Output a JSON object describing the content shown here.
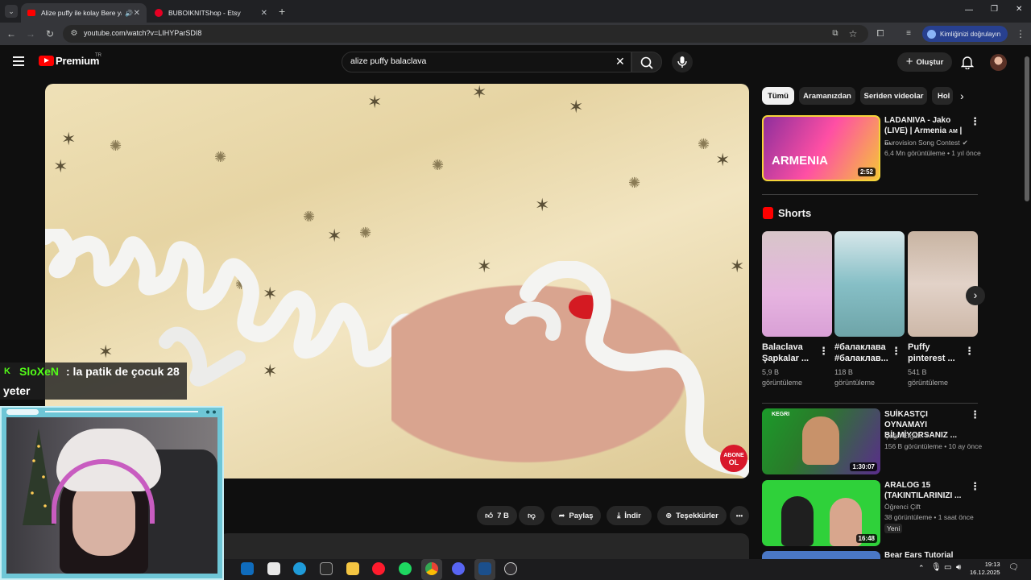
{
  "browser": {
    "tabs": [
      {
        "title": "Alize puffy ile kolay Bere ya",
        "favicon_color": "#ff0000"
      },
      {
        "title": "BUBOIKNITShop - Etsy",
        "favicon_color": "#e60023"
      }
    ],
    "new_tab_symbol": "+",
    "url": "youtube.com/watch?v=LIHYParSDI8",
    "profile_label": "Kimliğinizi doğrulayın"
  },
  "header": {
    "logo_text": "Premium",
    "logo_sup": "TR",
    "search_query": "alize puffy balaclava",
    "create_label": "Oluştur"
  },
  "video": {
    "subscribe_badge_line1": "ABONE",
    "subscribe_badge_line2": "OL"
  },
  "actions": {
    "likes": "7 B",
    "share": "Paylaş",
    "download": "İndir",
    "thanks": "Teşekkürler",
    "more": "•••"
  },
  "chat": {
    "badge": "K",
    "username": "SloXeN",
    "message": ": la patik de çocuk 28",
    "message_cont": "yeter"
  },
  "sidebar": {
    "chips": [
      "Tümü",
      "Aramanızdan",
      "Seriden videolar",
      "Hol"
    ],
    "video1": {
      "title": "LADANIVA - Jako (LIVE) | Armenia",
      "title_suffix": "AM",
      "channel": "Eurovision Song Contest",
      "meta": "6,4 Mn görüntüleme • 1 yıl önce",
      "duration": "2:52",
      "thumb_text": "ARMENIA"
    },
    "shorts_heading": "Shorts",
    "shorts": [
      {
        "title": "Balaclava Şapkalar ...",
        "views": "5,9 B görüntüleme"
      },
      {
        "title": "#балаклава #балаклав...",
        "views": "118 B görüntüleme"
      },
      {
        "title": "Puffy pinterest ...",
        "views": "541 B görüntüleme"
      }
    ],
    "video2": {
      "title": "SUİKASTÇI OYNAMAYI BİLMİYORSANIZ ...",
      "channel": "Çağrı Ergün",
      "meta": "156 B görüntüleme • 10 ay önce",
      "duration": "1:30:07",
      "thumb_text": "KEGRI"
    },
    "video3": {
      "title": "ARALOG 15 (TAKINTILARINIZI ...",
      "channel": "Öğrenci Çift",
      "meta": "38 görüntüleme • 1 saat önce",
      "badge": "Yeni",
      "duration": "16:48"
    },
    "video4": {
      "title": "Bear Ears Tutorial"
    }
  },
  "taskbar": {
    "time": "19:13",
    "date": "16.12.2025"
  },
  "colors": {
    "background": "#0f0f0f",
    "brand_red": "#ff0000",
    "kick_green": "#53fc18"
  }
}
